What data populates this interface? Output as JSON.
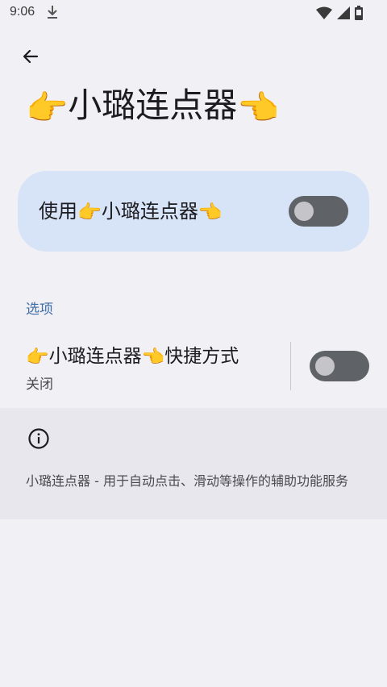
{
  "status_bar": {
    "time": "9:06"
  },
  "header": {
    "title_text": "小璐连点器",
    "left_emoji": "👉",
    "right_emoji": "👈"
  },
  "main_switch": {
    "label_prefix": "使用",
    "label_name": "小璐连点器",
    "left_emoji": "👉",
    "right_emoji": "👈",
    "state": "off"
  },
  "options_section": {
    "header": "选项",
    "shortcut": {
      "title_name": "小璐连点器",
      "title_suffix": "快捷方式",
      "left_emoji": "👉",
      "right_emoji": "👈",
      "summary": "关闭",
      "state": "off"
    }
  },
  "info": {
    "description": "小璐连点器 - 用于自动点击、滑动等操作的辅助功能服务"
  },
  "icons": {
    "back": "back-arrow-icon",
    "info": "info-icon",
    "download": "download-icon",
    "wifi": "wifi-icon",
    "signal": "cell-signal-icon",
    "battery": "battery-icon"
  },
  "colors": {
    "background": "#f1f0f5",
    "card": "#d7e3f7",
    "accent": "#3f6ea6",
    "toggle_track": "#5f6368",
    "toggle_knob": "#c4c4c9",
    "info_panel": "#e8e7ed"
  }
}
